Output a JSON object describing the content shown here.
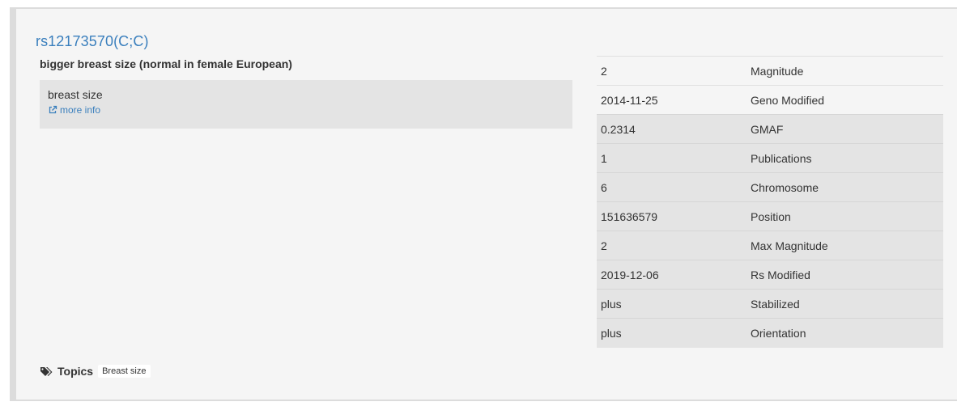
{
  "genotype": {
    "title": "rs12173570(C;C)",
    "summary": "bigger breast size (normal in female European)",
    "description": "breast size",
    "more_info_label": "more info"
  },
  "attributes": [
    {
      "value": "2",
      "label": "Magnitude"
    },
    {
      "value": "2014-11-25",
      "label": "Geno Modified"
    },
    {
      "value": "0.2314",
      "label": "GMAF"
    },
    {
      "value": "1",
      "label": "Publications"
    },
    {
      "value": "6",
      "label": "Chromosome"
    },
    {
      "value": "151636579",
      "label": "Position"
    },
    {
      "value": "2",
      "label": "Max Magnitude"
    },
    {
      "value": "2019-12-06",
      "label": "Rs Modified"
    },
    {
      "value": "plus",
      "label": "Stabilized"
    },
    {
      "value": "plus",
      "label": "Orientation"
    }
  ],
  "topics": {
    "label": "Topics",
    "items": [
      "Breast size"
    ]
  },
  "colors": {
    "link": "#3a7fbd",
    "panel_bg": "#f5f5f5",
    "shaded_row": "#e4e4e4"
  },
  "icons": {
    "more_info": "external-link-icon",
    "topics": "tags-icon"
  }
}
